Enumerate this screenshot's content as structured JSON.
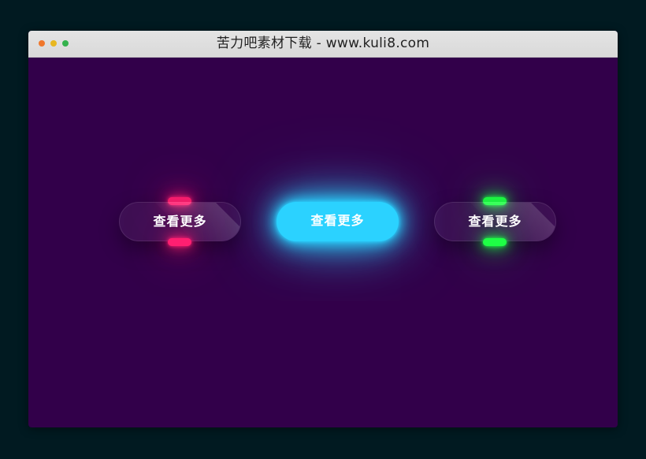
{
  "window": {
    "title": "苦力吧素材下载 - www.kuli8.com",
    "dots": [
      {
        "name": "close-dot",
        "color": "#f0772c"
      },
      {
        "name": "minimize-dot",
        "color": "#e8b720"
      },
      {
        "name": "maximize-dot",
        "color": "#34b24d"
      }
    ]
  },
  "colors": {
    "background": "#011a21",
    "stage": "#32004a",
    "pink": "#ff1f71",
    "blue": "#2bd2ff",
    "green": "#1eff45"
  },
  "buttons": [
    {
      "label": "查看更多",
      "accent": "pink",
      "state": "default"
    },
    {
      "label": "查看更多",
      "accent": "blue",
      "state": "hover"
    },
    {
      "label": "查看更多",
      "accent": "green",
      "state": "default"
    }
  ]
}
